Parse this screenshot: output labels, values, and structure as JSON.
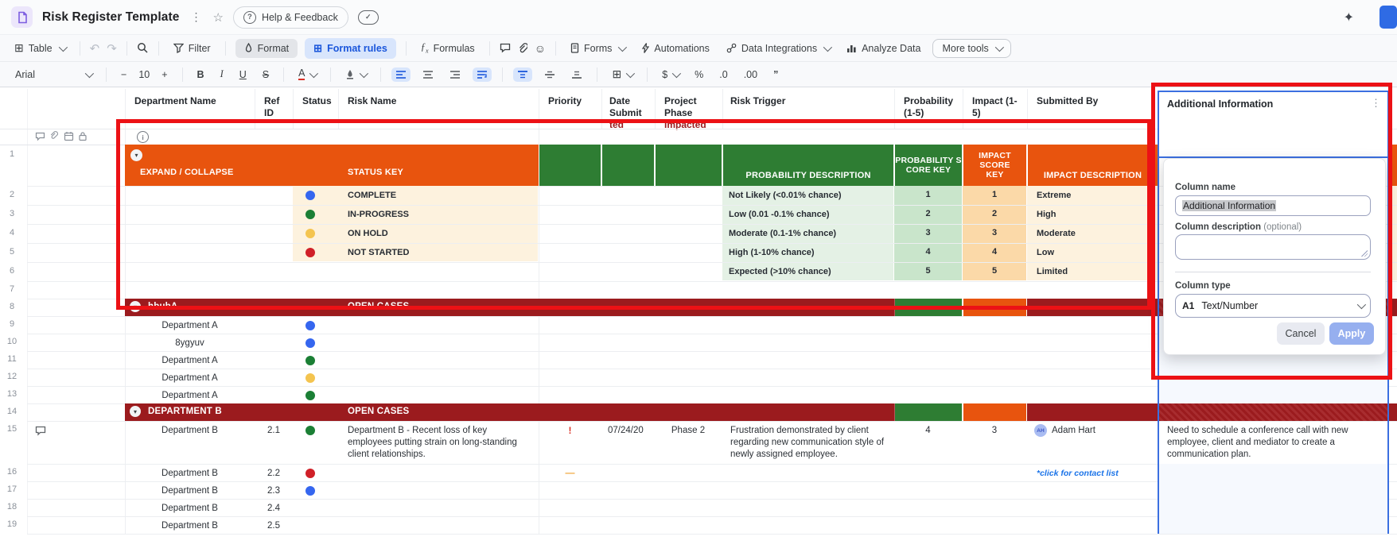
{
  "app": {
    "title": "Risk Register Template",
    "help_button": "Help & Feedback"
  },
  "toolbar": {
    "table": "Table",
    "filter": "Filter",
    "format": "Format",
    "format_rules": "Format rules",
    "formulas": "Formulas",
    "forms": "Forms",
    "automations": "Automations",
    "data_integrations": "Data Integrations",
    "analyze_data": "Analyze Data",
    "more_tools": "More tools"
  },
  "fontbar": {
    "font_name": "Arial",
    "font_size": "10",
    "minus": "−",
    "plus": "+",
    "bold": "B",
    "italic": "I",
    "underline": "U",
    "strikethrough": "S",
    "text_color": "A",
    "currency": "$",
    "percent": "%",
    "decrease_decimal": ".0",
    "increase_decimal": ".00",
    "quote": "”"
  },
  "grid": {
    "row_numbers": [
      "1",
      "2",
      "3",
      "4",
      "5",
      "6",
      "7",
      "8",
      "9",
      "10",
      "11",
      "12",
      "13",
      "14",
      "15",
      "16",
      "17",
      "18",
      "19"
    ],
    "headers": {
      "department": "Department Name",
      "ref": "Ref ID",
      "status": "Status",
      "risk_name": "Risk Name",
      "priority": "Priority",
      "date_submitted": "Date Submit",
      "date_submitted_overflow": "ted",
      "project_phase": "Project Phase",
      "project_phase_overflow": "Impacted",
      "risk_trigger": "Risk Trigger",
      "probability": "Probability (1-5)",
      "impact": "Impact (1-5)",
      "submitted_by": "Submitted By"
    },
    "key_header": {
      "expand_collapse": "EXPAND / COLLAPSE",
      "status_key": "STATUS KEY",
      "probability_description": "PROBABILITY DESCRIPTION",
      "probability_score_key": "PROBABILITY SCORE KEY",
      "impact_score_key": "IMPACT SCORE KEY",
      "impact_description": "IMPACT DESCRIPTION"
    },
    "status_key_rows": [
      {
        "label": "COMPLETE",
        "color": "#3566EF"
      },
      {
        "label": "IN-PROGRESS",
        "color": "#1B7F35"
      },
      {
        "label": "ON HOLD",
        "color": "#F4C44F"
      },
      {
        "label": "NOT STARTED",
        "color": "#D02028"
      }
    ],
    "probability_rows": [
      {
        "description": "Not Likely (<0.01% chance)",
        "score": "1"
      },
      {
        "description": "Low (0.01 -0.1% chance)",
        "score": "2"
      },
      {
        "description": "Moderate  (0.1-1% chance)",
        "score": "3"
      },
      {
        "description": "High (1-10% chance)",
        "score": "4"
      },
      {
        "description": "Expected (>10% chance)",
        "score": "5"
      }
    ],
    "impact_rows": [
      {
        "score": "1",
        "description": "Extreme"
      },
      {
        "score": "2",
        "description": "High"
      },
      {
        "score": "3",
        "description": "Moderate"
      },
      {
        "score": "4",
        "description": "Low"
      },
      {
        "score": "5",
        "description": "Limited"
      }
    ],
    "group_a": {
      "name": "hbubA",
      "label": "OPEN CASES"
    },
    "rows_a": [
      {
        "department": "Department A",
        "dot": "#3566EF"
      },
      {
        "department": "8ygyuv",
        "dot": "#3566EF"
      },
      {
        "department": "Department A",
        "dot": "#1B7F35"
      },
      {
        "department": "Department A",
        "dot": "#F4C44F"
      },
      {
        "department": "Department A",
        "dot": "#1B7F35"
      }
    ],
    "group_b": {
      "name": "DEPARTMENT B",
      "label": "OPEN CASES"
    },
    "row15": {
      "department": "Department B",
      "ref": "2.1",
      "dot": "#1B7F35",
      "risk_name": "Department B - Recent loss of key employees putting strain on long-standing client relationships.",
      "priority": "!",
      "date_submitted": "07/24/20",
      "project_phase": "Phase 2",
      "risk_trigger": "Frustration demonstrated by client regarding new communication style of newly assigned employee.",
      "probability": "4",
      "impact": "3",
      "avatar_initials": "AH",
      "submitted_by": "Adam Hart",
      "additional_information": "Need to schedule a conference call with new employee, client and mediator to create a communication plan."
    },
    "row16": {
      "department": "Department B",
      "ref": "2.2",
      "dot": "#D02028",
      "priority": "—",
      "submitted_by_note": "*click for contact list"
    },
    "row17": {
      "department": "Department B",
      "ref": "2.3",
      "dot": "#3566EF"
    },
    "row18": {
      "department": "Department B",
      "ref": "2.4"
    },
    "row19": {
      "department": "Department B",
      "ref": "2.5"
    }
  },
  "panel": {
    "column_header": "Additional Information",
    "column_name_label": "Column name",
    "column_name_value": "Additional Information",
    "column_description_label": "Column description",
    "column_description_optional": "(optional)",
    "column_type_label": "Column type",
    "column_type_badge": "A1",
    "column_type_value": "Text/Number",
    "cancel": "Cancel",
    "apply": "Apply"
  },
  "colors": {
    "key_orange": "#E8540E",
    "key_green": "#2E7D33",
    "group_dark_red": "#9B1B1E",
    "cream": "#FDF2DE",
    "light_green": "#E4F1E5",
    "score_green": "#C9E5CB",
    "score_orange": "#FBD9A8",
    "annotation_red": "#EC1115",
    "selection_blue": "#3B6FE0"
  }
}
